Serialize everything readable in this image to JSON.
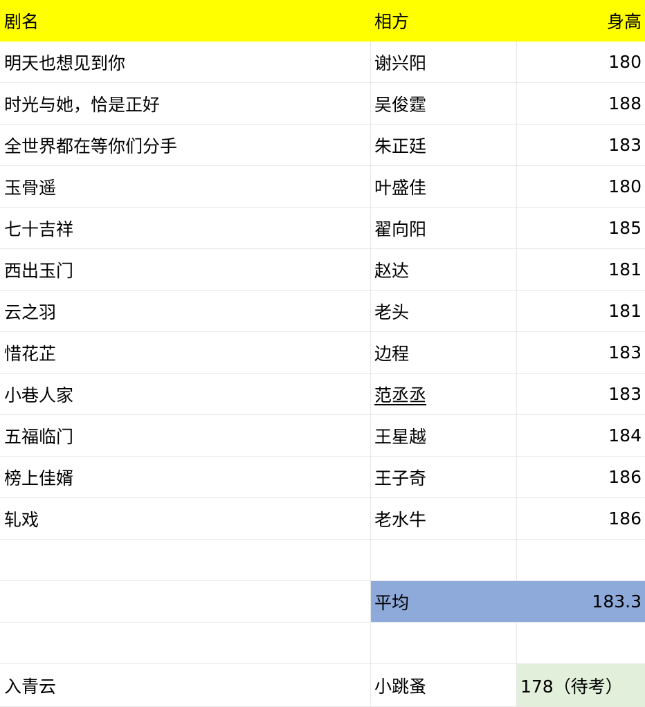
{
  "colors": {
    "header_fill": "#ffff00",
    "average_fill": "#8eaadb",
    "pending_fill": "#e2efda",
    "gridline": "#e6e6e6"
  },
  "header": {
    "col1": "剧名",
    "col2": "相方",
    "col3": "身高"
  },
  "rows": [
    {
      "drama": "明天也想见到你",
      "partner": "谢兴阳",
      "height": "180"
    },
    {
      "drama": "时光与她，恰是正好",
      "partner": "吴俊霆",
      "height": "188"
    },
    {
      "drama": "全世界都在等你们分手",
      "partner": "朱正廷",
      "height": "183"
    },
    {
      "drama": "玉骨遥",
      "partner": "叶盛佳",
      "height": "180"
    },
    {
      "drama": "七十吉祥",
      "partner": "翟向阳",
      "height": "185"
    },
    {
      "drama": "西出玉门",
      "partner": "赵达",
      "height": "181"
    },
    {
      "drama": "云之羽",
      "partner": "老头",
      "height": "181"
    },
    {
      "drama": "惜花芷",
      "partner": "边程",
      "height": "183"
    },
    {
      "drama": "小巷人家",
      "partner": "范丞丞",
      "height": "183"
    },
    {
      "drama": "五福临门",
      "partner": "王星越",
      "height": "184"
    },
    {
      "drama": "榜上佳婿",
      "partner": "王子奇",
      "height": "186"
    },
    {
      "drama": "轧戏",
      "partner": "老水牛",
      "height": "186"
    }
  ],
  "average": {
    "label": "平均",
    "value": "183.3"
  },
  "pending": {
    "drama": "入青云",
    "partner": "小跳蚤",
    "height": "178（待考）"
  }
}
